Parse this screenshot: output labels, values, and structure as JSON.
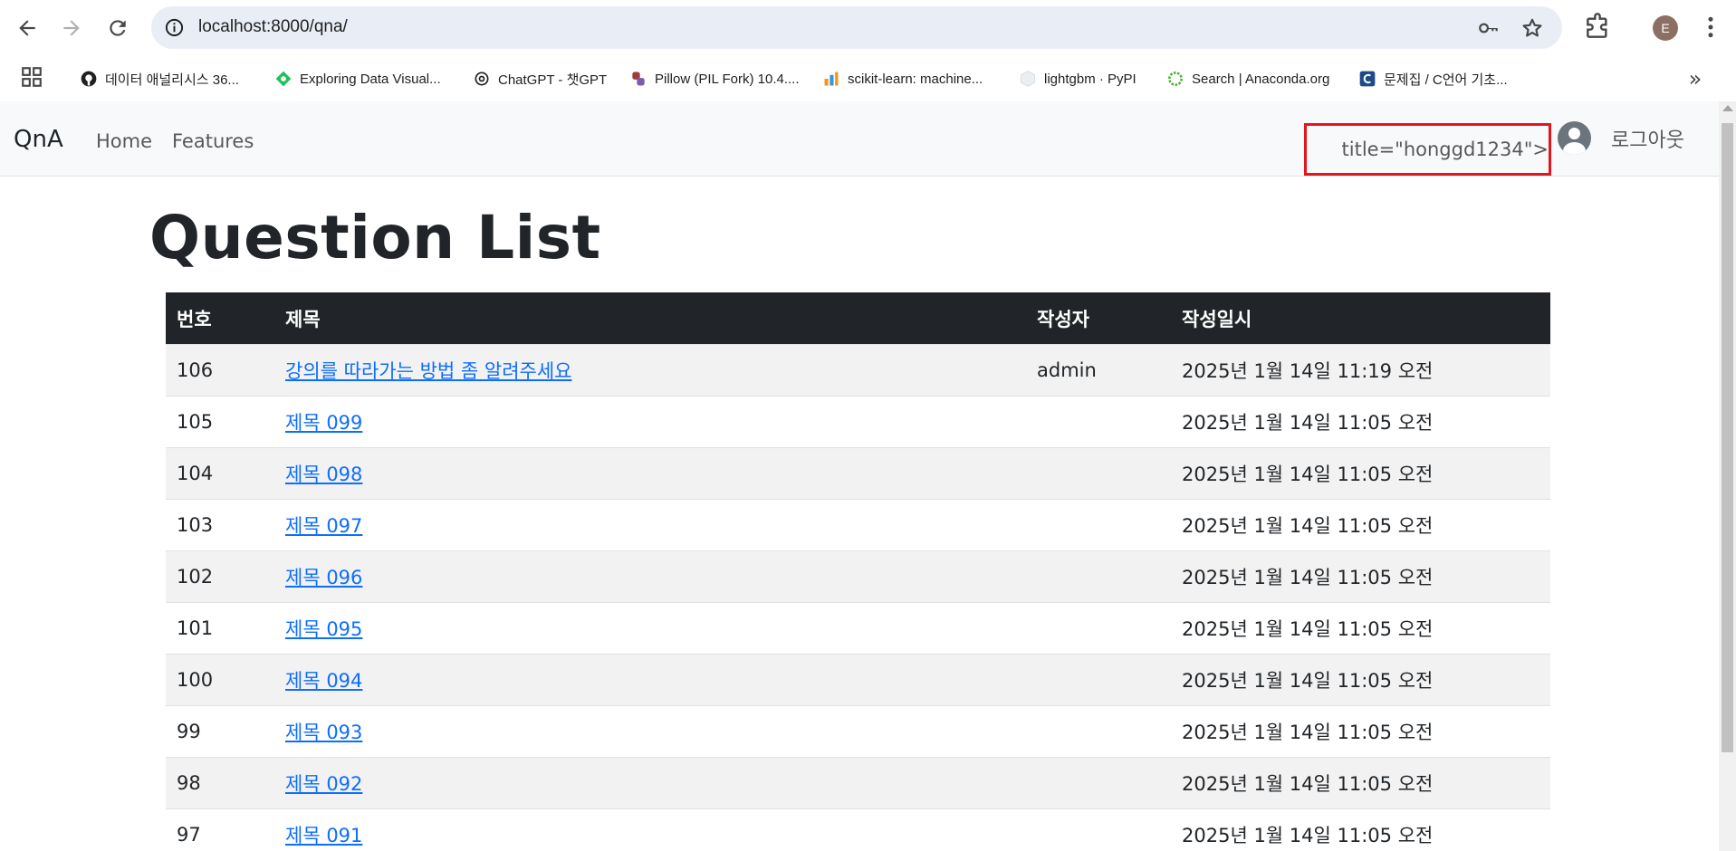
{
  "browser": {
    "url": "localhost:8000/qna/",
    "profile_initial": "E",
    "bookmarks": [
      {
        "label": "데이터 애널리시스 36...",
        "icon": "github-icon"
      },
      {
        "label": "Exploring Data Visual...",
        "icon": "diamond-icon"
      },
      {
        "label": "ChatGPT - 챗GPT",
        "icon": "openai-icon"
      },
      {
        "label": "Pillow (PIL Fork) 10.4....",
        "icon": "python-icon"
      },
      {
        "label": "scikit-learn: machine...",
        "icon": "bars-icon"
      },
      {
        "label": "lightgbm · PyPI",
        "icon": "cube-icon"
      },
      {
        "label": "Search | Anaconda.org",
        "icon": "ring-icon"
      },
      {
        "label": "문제집 / C언어 기초...",
        "icon": "c-icon"
      }
    ],
    "more_symbol": "»"
  },
  "navbar": {
    "brand": "QnA",
    "links": [
      "Home",
      "Features"
    ],
    "user_title_text": "title=\"honggd1234\">",
    "logout": "로그아웃",
    "highlight_color": "#e3141d"
  },
  "main": {
    "title": "Question List",
    "columns": [
      "번호",
      "제목",
      "작성자",
      "작성일시"
    ],
    "rows": [
      {
        "num": "106",
        "title": "강의를 따라가는 방법 좀 알려주세요",
        "author": "admin",
        "date": "2025년 1월 14일 11:19 오전"
      },
      {
        "num": "105",
        "title": "제목 099",
        "author": "",
        "date": "2025년 1월 14일 11:05 오전"
      },
      {
        "num": "104",
        "title": "제목 098",
        "author": "",
        "date": "2025년 1월 14일 11:05 오전"
      },
      {
        "num": "103",
        "title": "제목 097",
        "author": "",
        "date": "2025년 1월 14일 11:05 오전"
      },
      {
        "num": "102",
        "title": "제목 096",
        "author": "",
        "date": "2025년 1월 14일 11:05 오전"
      },
      {
        "num": "101",
        "title": "제목 095",
        "author": "",
        "date": "2025년 1월 14일 11:05 오전"
      },
      {
        "num": "100",
        "title": "제목 094",
        "author": "",
        "date": "2025년 1월 14일 11:05 오전"
      },
      {
        "num": "99",
        "title": "제목 093",
        "author": "",
        "date": "2025년 1월 14일 11:05 오전"
      },
      {
        "num": "98",
        "title": "제목 092",
        "author": "",
        "date": "2025년 1월 14일 11:05 오전"
      },
      {
        "num": "97",
        "title": "제목 091",
        "author": "",
        "date": "2025년 1월 14일 11:05 오전"
      }
    ]
  }
}
